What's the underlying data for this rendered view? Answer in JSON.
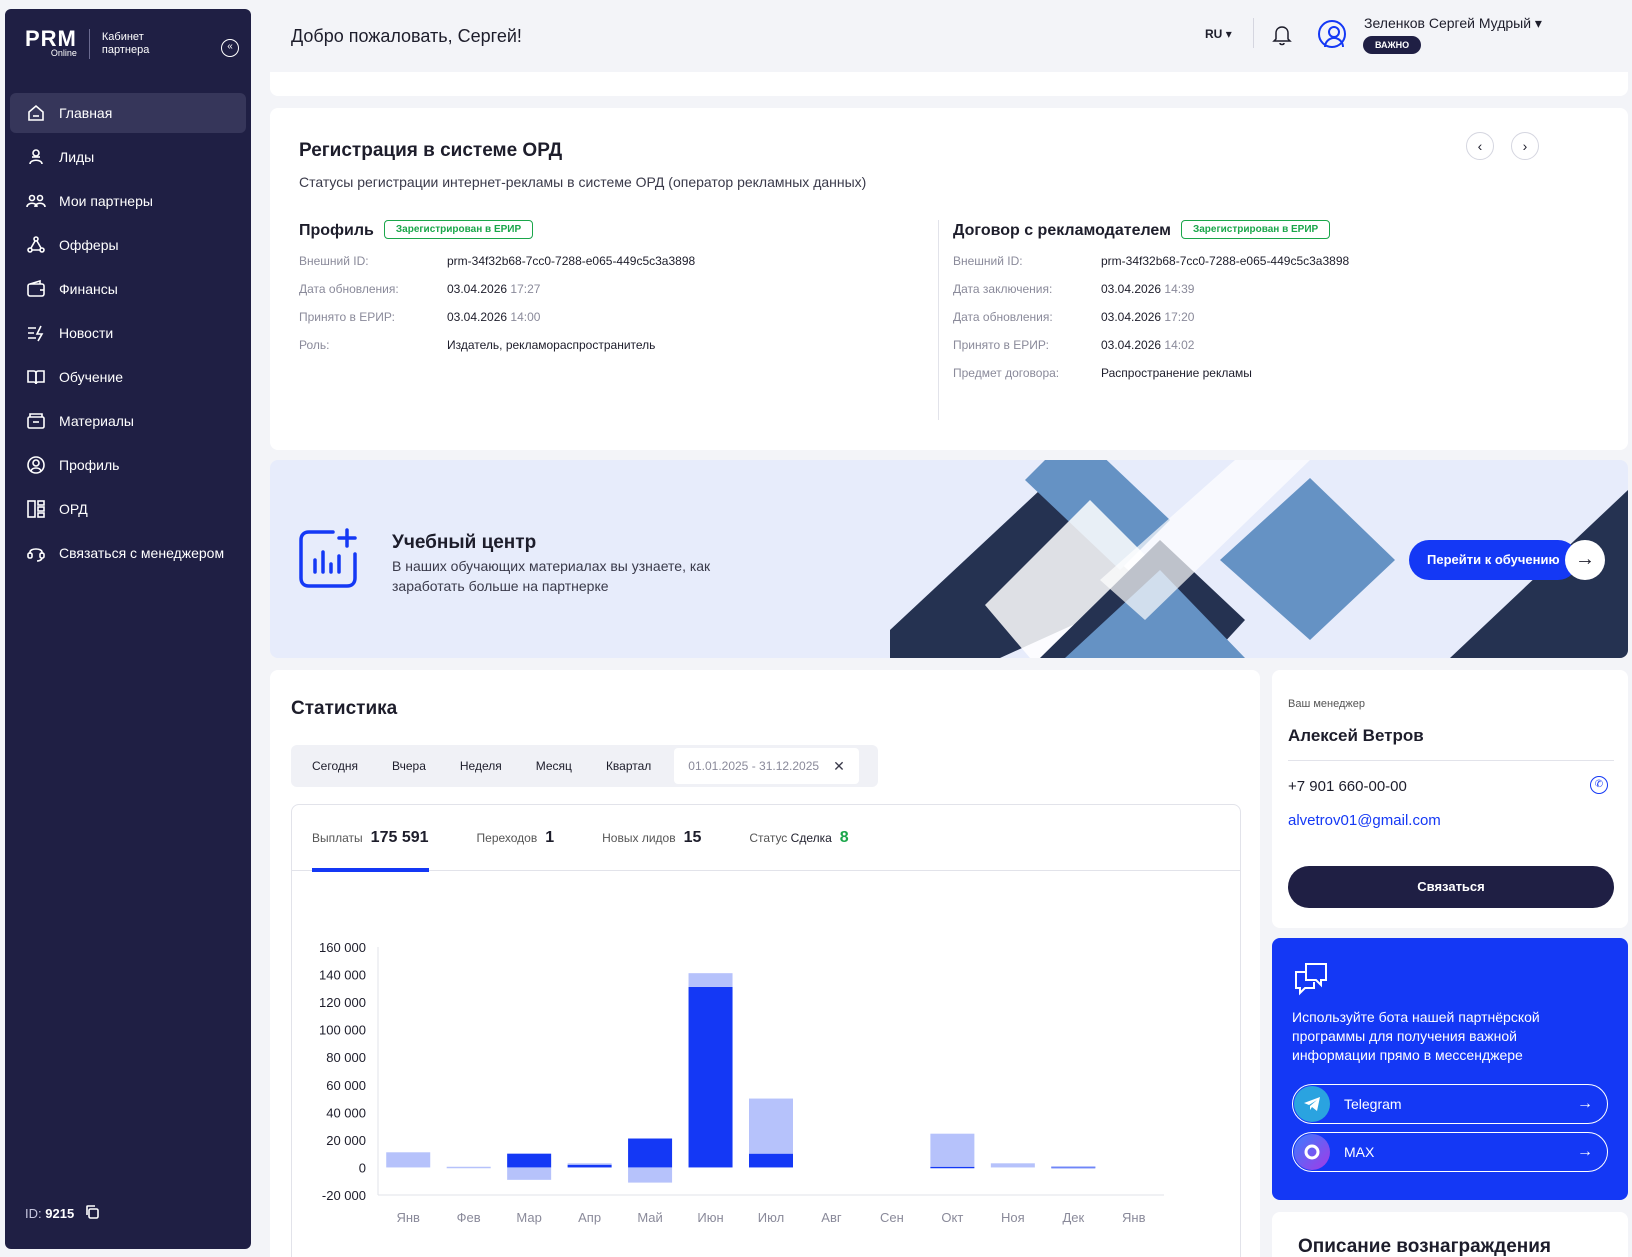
{
  "sidebar": {
    "logo": "PRM",
    "logo_small": "Online",
    "cabinet_label": "Кабинет партнера",
    "items": [
      {
        "label": "Главная",
        "icon": "home-icon",
        "active": true
      },
      {
        "label": "Лиды",
        "icon": "leads-icon"
      },
      {
        "label": "Мои партнеры",
        "icon": "partners-icon"
      },
      {
        "label": "Офферы",
        "icon": "offers-icon"
      },
      {
        "label": "Финансы",
        "icon": "wallet-icon"
      },
      {
        "label": "Новости",
        "icon": "news-icon"
      },
      {
        "label": "Обучение",
        "icon": "book-icon"
      },
      {
        "label": "Материалы",
        "icon": "materials-icon"
      },
      {
        "label": "Профиль",
        "icon": "profile-icon"
      },
      {
        "label": "ОРД",
        "icon": "ord-icon"
      },
      {
        "label": "Связаться с менеджером",
        "icon": "headset-icon"
      }
    ],
    "id_label": "ID:",
    "id_value": "9215"
  },
  "header": {
    "welcome": "Добро пожаловать, Сергей!",
    "lang": "RU",
    "user_name": "Зеленков Сергей Мудрый",
    "user_badge": "ВАЖНО"
  },
  "ord": {
    "title": "Регистрация в системе ОРД",
    "subtitle": "Статусы регистрации интернет-рекламы в системе ОРД (оператор рекламных данных)",
    "profile": {
      "title": "Профиль",
      "badge": "Зарегистрирован в ЕРИР",
      "rows": [
        {
          "k": "Внешний ID:",
          "v": "prm-34f32b68-7cc0-7288-e065-449c5c3a3898",
          "t": ""
        },
        {
          "k": "Дата обновления:",
          "v": "03.04.2026",
          "t": "17:27"
        },
        {
          "k": "Принято в ЕРИР:",
          "v": "03.04.2026",
          "t": "14:00"
        },
        {
          "k": "Роль:",
          "v": "Издатель, рекламораспространитель",
          "t": ""
        }
      ]
    },
    "contract": {
      "title": "Договор с рекламодателем",
      "badge": "Зарегистрирован в ЕРИР",
      "rows": [
        {
          "k": "Внешний ID:",
          "v": "prm-34f32b68-7cc0-7288-e065-449c5c3a3898",
          "t": ""
        },
        {
          "k": "Дата заключения:",
          "v": "03.04.2026",
          "t": "14:39"
        },
        {
          "k": "Дата обновления:",
          "v": "03.04.2026",
          "t": "17:20"
        },
        {
          "k": "Принято в ЕРИР:",
          "v": "03.04.2026",
          "t": "14:02"
        },
        {
          "k": "Предмет договора:",
          "v": "Распространение рекламы",
          "t": ""
        }
      ]
    }
  },
  "banner": {
    "title": "Учебный центр",
    "text": "В наших обучающих материалах вы узнаете, как заработать больше на партнерке",
    "cta": "Перейти к обучению"
  },
  "stats": {
    "title": "Статистика",
    "periods": [
      "Сегодня",
      "Вчера",
      "Неделя",
      "Месяц",
      "Квартал"
    ],
    "date_range": "01.01.2025 - 31.12.2025",
    "metrics": [
      {
        "label": "Выплаты",
        "value": "175 591",
        "active": true
      },
      {
        "label": "Переходов",
        "value": "1"
      },
      {
        "label": "Новых лидов",
        "value": "15"
      },
      {
        "label": "Статус",
        "label_strong": "Сделка",
        "value": "8"
      }
    ]
  },
  "chart_data": {
    "type": "bar",
    "categories": [
      "Янв",
      "Фев",
      "Мар",
      "Апр",
      "Май",
      "Июн",
      "Июл",
      "Авг",
      "Сен",
      "Окт",
      "Ноя",
      "Дек",
      "Янв"
    ],
    "series": [
      {
        "values": [
          0,
          0,
          10000,
          2000,
          21000,
          131000,
          10000,
          0,
          0,
          500,
          0,
          500,
          0
        ],
        "color": "#1438f5"
      },
      {
        "values": [
          11000,
          500,
          -9000,
          1000,
          -11000,
          10000,
          40000,
          0,
          0,
          24000,
          3000,
          500,
          0
        ],
        "color": "#b6c2fb"
      }
    ],
    "y_ticks": [
      "160 000",
      "140 000",
      "120 000",
      "100 000",
      "80 000",
      "60 000",
      "40 000",
      "20 000",
      "0",
      "-20 000"
    ],
    "ylim": [
      -20000,
      160000
    ],
    "stacked": true
  },
  "manager": {
    "label": "Ваш менеджер",
    "name": "Алексей Ветров",
    "phone": "+7 901 660-00-00",
    "email": "alvetrov01@gmail.com",
    "button": "Связаться"
  },
  "bot": {
    "text": "Используйте бота нашей партнёрской программы для получения важной информации прямо в мессенджере",
    "links": [
      {
        "label": "Telegram",
        "color": "#2aa3e0"
      },
      {
        "label": "MAX",
        "color": "#8a3ce6"
      }
    ]
  },
  "reward": {
    "title": "Описание вознаграждения"
  }
}
